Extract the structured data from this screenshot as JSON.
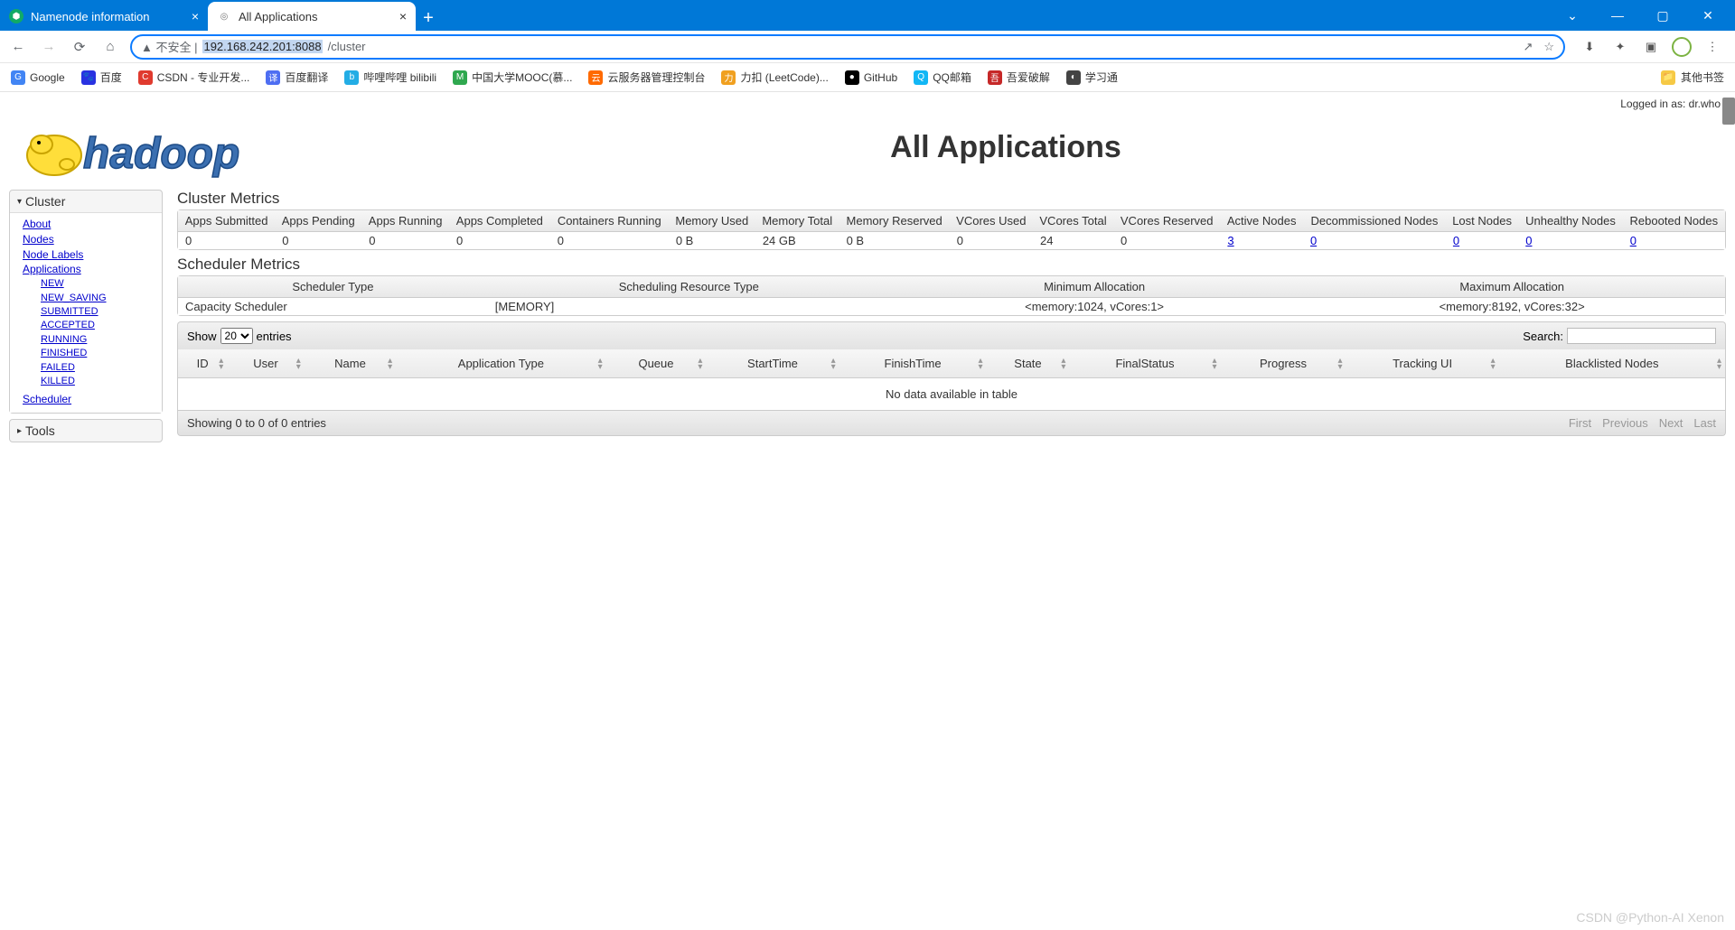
{
  "browser": {
    "tabs": [
      {
        "title": "Namenode information",
        "active": false
      },
      {
        "title": "All Applications",
        "active": true
      }
    ],
    "url_prefix": "▲ 不安全 | ",
    "url_highlight": "192.168.242.201:8088",
    "url_suffix": "/cluster",
    "bookmarks": [
      {
        "label": "Google",
        "icon": "G",
        "color": "#4285F4"
      },
      {
        "label": "百度",
        "icon": "🐾",
        "color": "#2932E1"
      },
      {
        "label": "CSDN - 专业开发...",
        "icon": "C",
        "color": "#e03b2f"
      },
      {
        "label": "百度翻译",
        "icon": "译",
        "color": "#4e6ef2"
      },
      {
        "label": "哔哩哔哩 bilibili",
        "icon": "b",
        "color": "#23ade5"
      },
      {
        "label": "中国大学MOOC(慕...",
        "icon": "M",
        "color": "#2fa84f"
      },
      {
        "label": "云服务器管理控制台",
        "icon": "云",
        "color": "#ff6a00"
      },
      {
        "label": "力扣 (LeetCode)...",
        "icon": "力",
        "color": "#f0a020"
      },
      {
        "label": "GitHub",
        "icon": "●",
        "color": "#000"
      },
      {
        "label": "QQ邮箱",
        "icon": "Q",
        "color": "#12b7f5"
      },
      {
        "label": "吾爱破解",
        "icon": "吾",
        "color": "#c62828"
      },
      {
        "label": "学习通",
        "icon": "◐",
        "color": "#444"
      }
    ],
    "other_bookmarks": "其他书签"
  },
  "page": {
    "login_text": "Logged in as: dr.who",
    "title": "All Applications",
    "sidebar": {
      "cluster_label": "Cluster",
      "tools_label": "Tools",
      "links": [
        "About",
        "Nodes",
        "Node Labels",
        "Applications"
      ],
      "app_states": [
        "NEW",
        "NEW_SAVING",
        "SUBMITTED",
        "ACCEPTED",
        "RUNNING",
        "FINISHED",
        "FAILED",
        "KILLED"
      ],
      "scheduler_link": "Scheduler"
    },
    "cluster_metrics": {
      "heading": "Cluster Metrics",
      "headers": [
        "Apps Submitted",
        "Apps Pending",
        "Apps Running",
        "Apps Completed",
        "Containers Running",
        "Memory Used",
        "Memory Total",
        "Memory Reserved",
        "VCores Used",
        "VCores Total",
        "VCores Reserved",
        "Active Nodes",
        "Decommissioned Nodes",
        "Lost Nodes",
        "Unhealthy Nodes",
        "Rebooted Nodes"
      ],
      "values": [
        "0",
        "0",
        "0",
        "0",
        "0",
        "0 B",
        "24 GB",
        "0 B",
        "0",
        "24",
        "0",
        "3",
        "0",
        "0",
        "0",
        "0"
      ],
      "link_flags": [
        false,
        false,
        false,
        false,
        false,
        false,
        false,
        false,
        false,
        false,
        false,
        true,
        true,
        true,
        true,
        true
      ]
    },
    "scheduler_metrics": {
      "heading": "Scheduler Metrics",
      "headers": [
        "Scheduler Type",
        "Scheduling Resource Type",
        "Minimum Allocation",
        "Maximum Allocation"
      ],
      "values": [
        "Capacity Scheduler",
        "[MEMORY]",
        "<memory:1024, vCores:1>",
        "<memory:8192, vCores:32>"
      ]
    },
    "apps_table": {
      "show_label_pre": "Show",
      "show_label_post": "entries",
      "show_value": "20",
      "search_label": "Search:",
      "headers": [
        "ID",
        "User",
        "Name",
        "Application Type",
        "Queue",
        "StartTime",
        "FinishTime",
        "State",
        "FinalStatus",
        "Progress",
        "Tracking UI",
        "Blacklisted Nodes"
      ],
      "empty_text": "No data available in table",
      "info": "Showing 0 to 0 of 0 entries",
      "paginate": [
        "First",
        "Previous",
        "Next",
        "Last"
      ]
    }
  },
  "watermark": "CSDN @Python-AI Xenon"
}
